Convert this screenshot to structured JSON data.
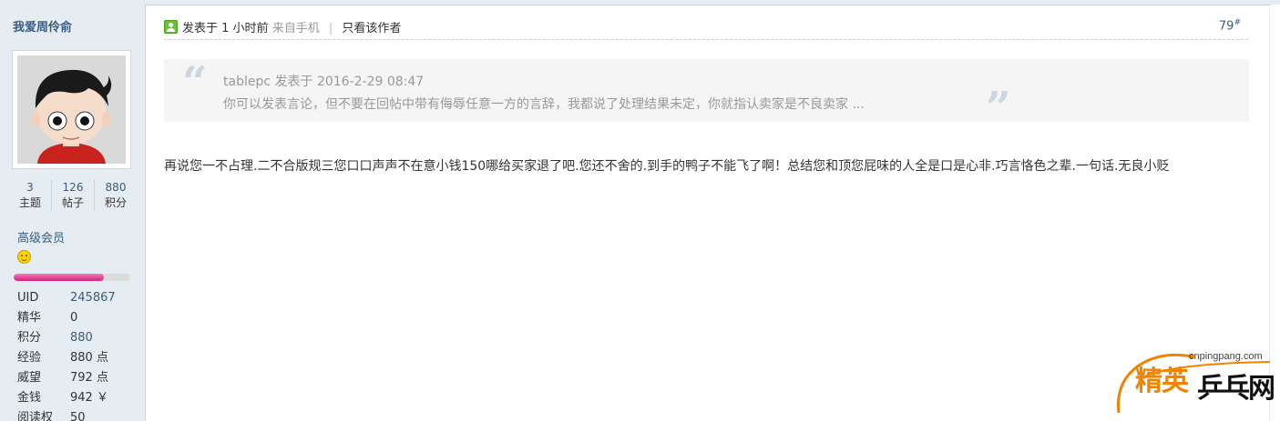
{
  "sidebar": {
    "username": "我爱周伶俞",
    "stats": [
      {
        "value": "3",
        "label": "主题"
      },
      {
        "value": "126",
        "label": "帖子"
      },
      {
        "value": "880",
        "label": "积分"
      }
    ],
    "group": "高级会员",
    "progress": 0.77,
    "info": [
      {
        "key": "UID",
        "value": "245867",
        "link": true
      },
      {
        "key": "精华",
        "value": "0",
        "link": false
      },
      {
        "key": "积分",
        "value": "880",
        "link": true
      },
      {
        "key": "经验",
        "value": "880 点",
        "link": false
      },
      {
        "key": "威望",
        "value": "792 点",
        "link": false
      },
      {
        "key": "金钱",
        "value": "942 ￥",
        "link": false
      },
      {
        "key": "阅读权",
        "value": "50",
        "link": false
      }
    ]
  },
  "post": {
    "posted_at": "发表于 1 小时前",
    "source": "来自手机",
    "separator": "|",
    "only_author": "只看该作者",
    "floor": "79",
    "floor_sup": "#",
    "quote": {
      "open_mark": "“",
      "close_mark": "”",
      "author_line": "tablepc 发表于 2016-2-29 08:47",
      "text": "你可以发表言论，但不要在回帖中带有侮辱任意一方的言辞，我都说了处理结果未定，你就指认卖家是不良卖家 ..."
    },
    "content": "再说您一不占理.二不合版规三您口口声声不在意小钱150哪给买家退了吧.您还不舍的.到手的鸭子不能飞了啊！总结您和顶您屁味的人全是口是心非.巧言恪色之辈.一句话.无良小贬"
  },
  "watermark": {
    "url": "cnpingpang.com",
    "brand_a": "精英",
    "brand_b": "乒乓网"
  },
  "colors": {
    "sidebar_bg": "#e5edf2",
    "link": "#3a5c80",
    "muted": "#999999",
    "brand_orange": "#f08300",
    "progress": "#d6237c"
  }
}
